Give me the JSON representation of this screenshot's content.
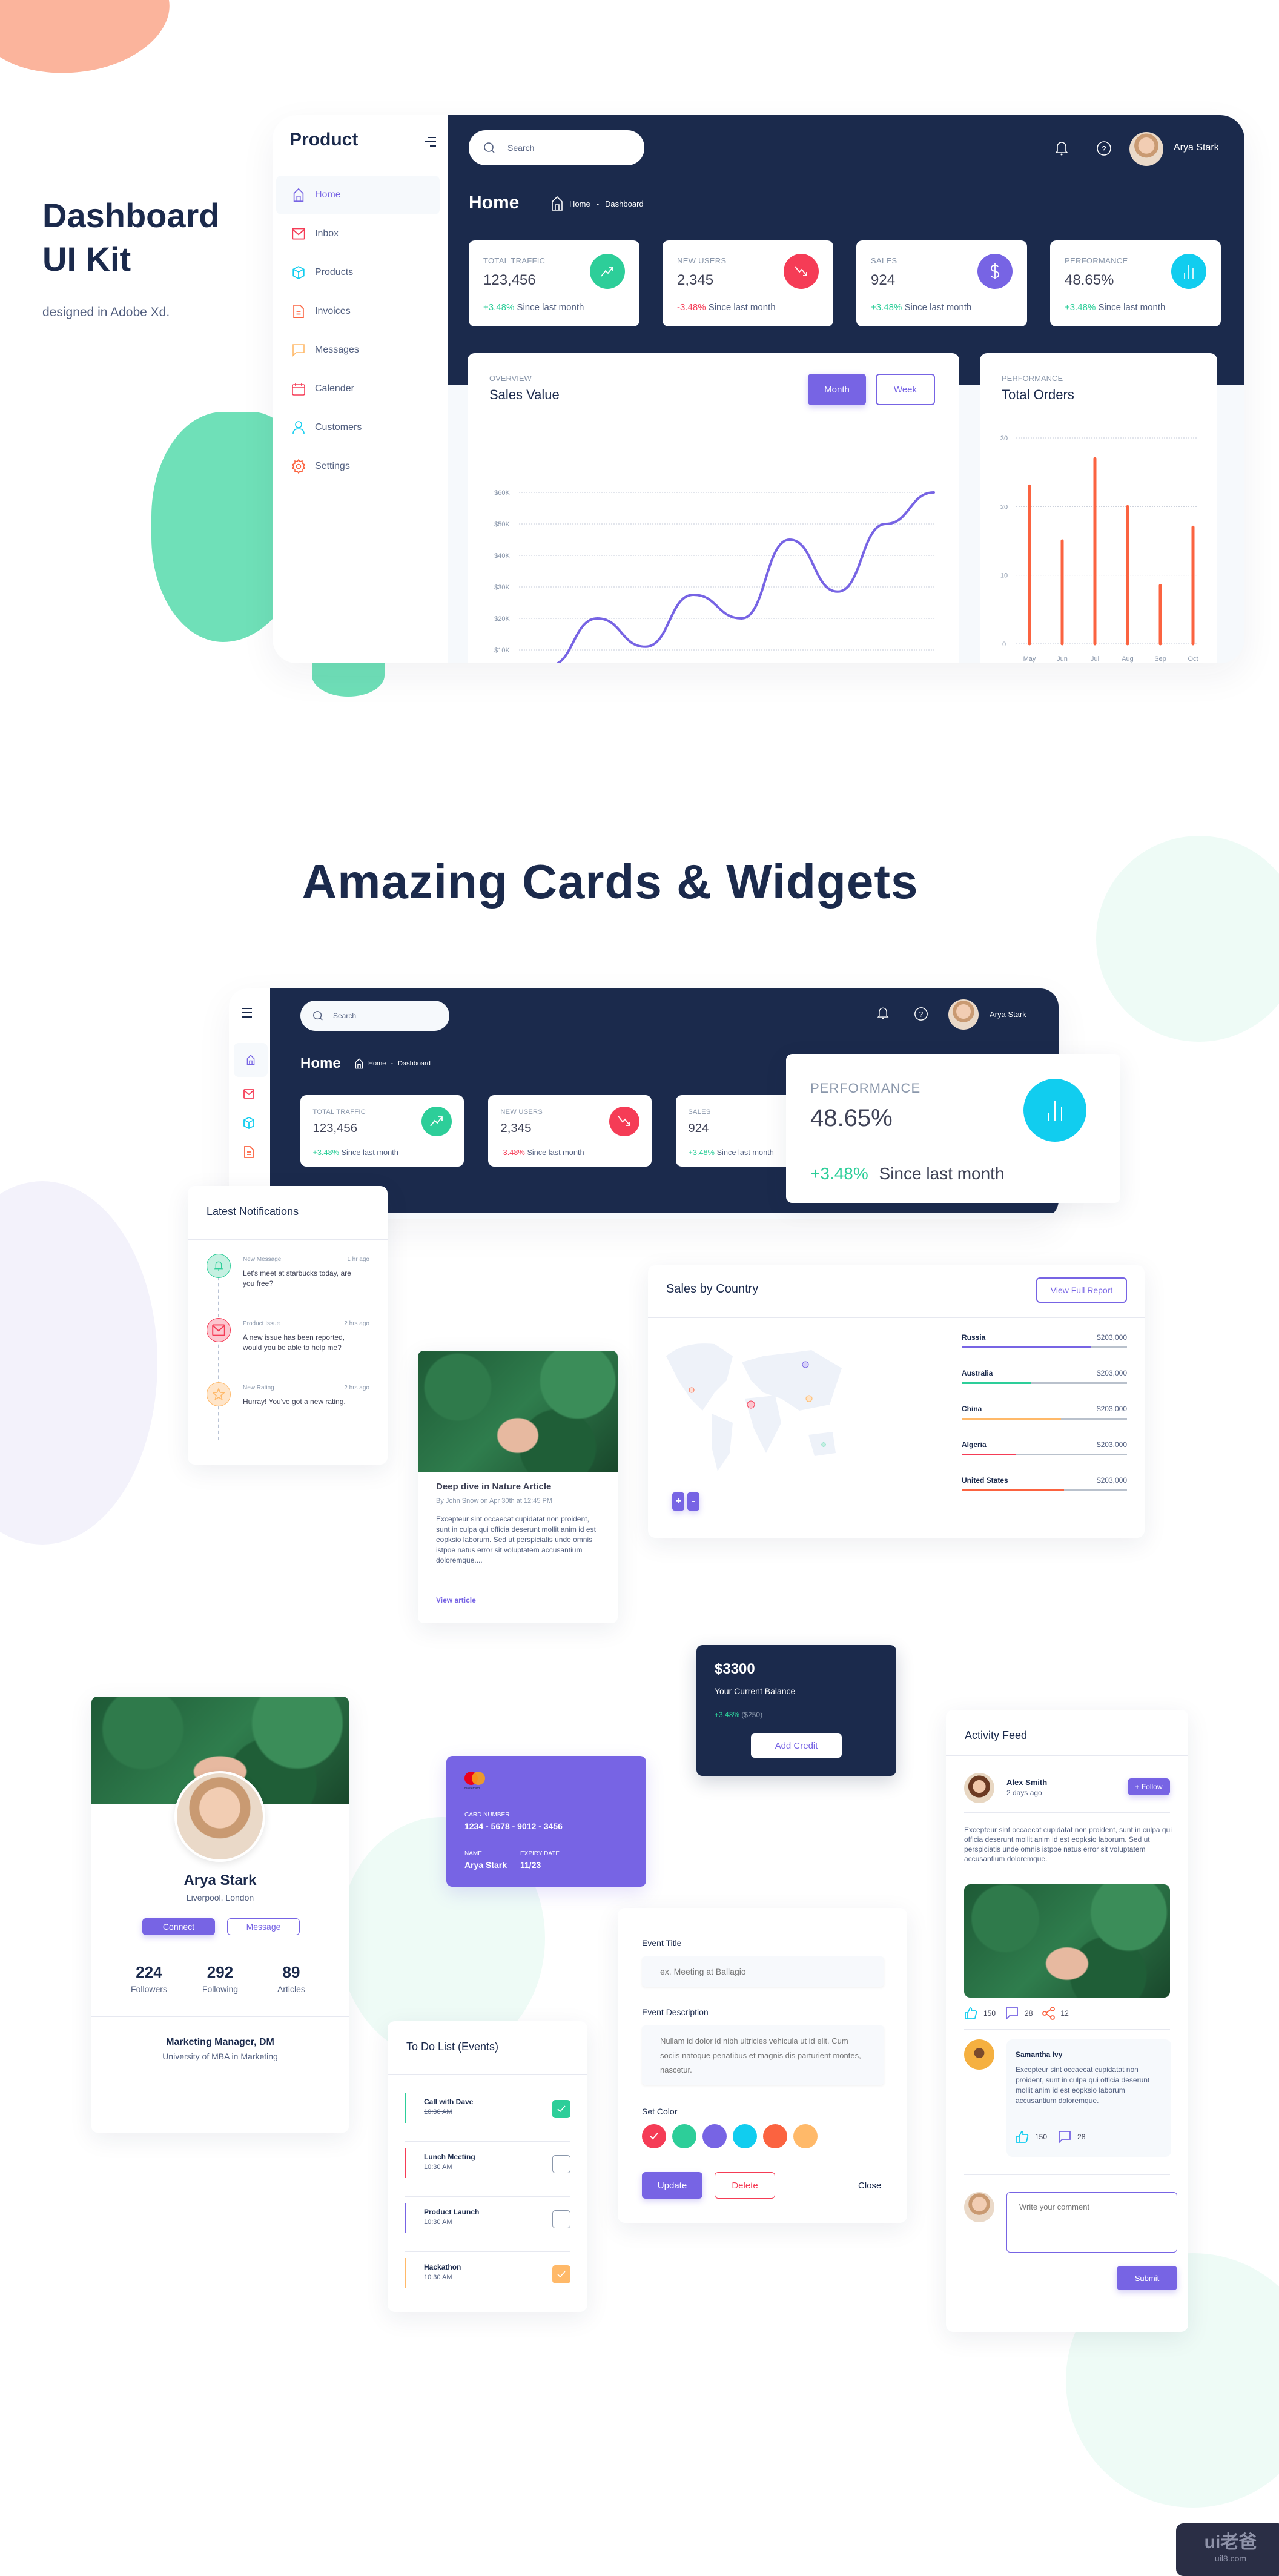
{
  "hero": {
    "title_line1": "Dashboard",
    "title_line2": "UI Kit",
    "subtitle": "designed in Adobe Xd."
  },
  "section_heading": "Amazing Cards & Widgets",
  "dashboard": {
    "brand": "Product",
    "sidebar": [
      {
        "label": "Home",
        "icon": "home-icon",
        "color": "#7764e4",
        "active": true
      },
      {
        "label": "Inbox",
        "icon": "mail-icon",
        "color": "#f53c56"
      },
      {
        "label": "Products",
        "icon": "box-icon",
        "color": "#11cdef"
      },
      {
        "label": "Invoices",
        "icon": "document-icon",
        "color": "#fb6340"
      },
      {
        "label": "Messages",
        "icon": "chat-icon",
        "color": "#ffb969"
      },
      {
        "label": "Calender",
        "icon": "calendar-icon",
        "color": "#f53c56"
      },
      {
        "label": "Customers",
        "icon": "user-icon",
        "color": "#11cdef"
      },
      {
        "label": "Settings",
        "icon": "gear-icon",
        "color": "#fb6340"
      }
    ],
    "search_placeholder": "Search",
    "user_name": "Arya Stark",
    "page_title": "Home",
    "breadcrumb": [
      "Home",
      "-",
      "Dashboard"
    ],
    "stats": [
      {
        "label": "TOTAL TRAFFIC",
        "value": "123,456",
        "change": "+3.48%",
        "since": "Since last month",
        "trend": "up",
        "icon": "trend-up-icon",
        "color": "#2dce99"
      },
      {
        "label": "NEW USERS",
        "value": "2,345",
        "change": "-3.48%",
        "since": "Since last month",
        "trend": "down",
        "icon": "trend-down-icon",
        "color": "#f53c56"
      },
      {
        "label": "SALES",
        "value": "924",
        "change": "+3.48%",
        "since": "Since last month",
        "trend": "up",
        "icon": "dollar-icon",
        "color": "#7764e4"
      },
      {
        "label": "PERFORMANCE",
        "value": "48.65%",
        "change": "+3.48%",
        "since": "Since last month",
        "trend": "up",
        "icon": "bar-chart-icon",
        "color": "#11cdef"
      }
    ],
    "sales_card": {
      "overline": "OVERVIEW",
      "title": "Sales Value",
      "btn_month": "Month",
      "btn_week": "Week"
    },
    "orders_card": {
      "overline": "PERFORMANCE",
      "title": "Total Orders"
    }
  },
  "chart_data": [
    {
      "type": "line",
      "title": "Sales Value",
      "ylabel": "",
      "xlabel": "",
      "yticks": [
        "$10K",
        "$20K",
        "$30K",
        "$40K",
        "$50K",
        "$60K"
      ],
      "ylim": [
        10,
        60
      ],
      "x": [
        0,
        1,
        2,
        3,
        4,
        5,
        6,
        7,
        8,
        9,
        10
      ],
      "values": [
        5,
        20,
        11,
        27.5,
        20,
        45,
        28.5,
        50,
        60
      ],
      "grid": true,
      "color": "#7764e4"
    },
    {
      "type": "bar",
      "title": "Total Orders",
      "categories": [
        "May",
        "Jun",
        "Jul",
        "Aug",
        "Sep",
        "Oct"
      ],
      "values": [
        23,
        15,
        27,
        20,
        8.5,
        17
      ],
      "yticks": [
        "0",
        "10",
        "20",
        "30"
      ],
      "ylim": [
        0,
        30
      ],
      "grid": true,
      "color": "#fb6340"
    }
  ],
  "widgets": {
    "mini_dash": {
      "search_placeholder": "Search",
      "user_name": "Arya Stark",
      "page_title": "Home",
      "breadcrumb": [
        "Home",
        "-",
        "Dashboard"
      ]
    },
    "performance_card": {
      "label": "PERFORMANCE",
      "value": "48.65%",
      "change": "+3.48%",
      "since": "Since last month"
    },
    "notifications": {
      "title": "Latest Notifications",
      "items": [
        {
          "type": "New Message",
          "time": "1 hr ago",
          "text": "Let's meet at starbucks today, are you free?",
          "icon": "bell-icon",
          "color": "#2dce99",
          "bg": "#c5f0e1"
        },
        {
          "type": "Product Issue",
          "time": "2 hrs ago",
          "text": "A new issue has been reported, would you be able to help me?",
          "icon": "mail-icon",
          "color": "#f53c56",
          "bg": "#fcc6cf"
        },
        {
          "type": "New Rating",
          "time": "2 hrs ago",
          "text": "Hurray! You've got a new rating.",
          "icon": "star-icon",
          "color": "#ffb969",
          "bg": "#ffe5c9"
        }
      ]
    },
    "sales_by_country": {
      "title": "Sales by Country",
      "button": "View Full Report",
      "zoom_in": "+",
      "zoom_out": "-",
      "countries": [
        {
          "name": "Russia",
          "amount": "$203,000",
          "progress": 0.78,
          "color": "#7764e4"
        },
        {
          "name": "Australia",
          "amount": "$203,000",
          "progress": 0.42,
          "color": "#2dce99"
        },
        {
          "name": "China",
          "amount": "$203,000",
          "progress": 0.6,
          "color": "#ffb969"
        },
        {
          "name": "Algeria",
          "amount": "$203,000",
          "progress": 0.33,
          "color": "#f53c56"
        },
        {
          "name": "United States",
          "amount": "$203,000",
          "progress": 0.62,
          "color": "#fb6340"
        }
      ]
    },
    "article": {
      "title": "Deep dive in Nature Article",
      "meta": "By John Snow on Apr 30th at 12:45 PM",
      "body": "Excepteur sint occaecat cupidatat non proident, sunt in culpa qui officia deserunt mollit anim id est eopksio laborum. Sed ut perspiciatis unde omnis istpoe natus error sit voluptatem accusantium doloremque....",
      "link": "View article"
    },
    "balance": {
      "amount": "$3300",
      "label": "Your Current Balance",
      "change": "+3.48%",
      "change_amount": "($250)",
      "button": "Add Credit"
    },
    "credit_card": {
      "brand": "mastercard",
      "number_label": "CARD NUMBER",
      "number": "1234 - 5678 - 9012 - 3456",
      "name_label": "NAME",
      "name": "Arya Stark",
      "expiry_label": "EXPIRY DATE",
      "expiry": "11/23"
    },
    "profile": {
      "name": "Arya Stark",
      "location": "Liverpool, London",
      "connect": "Connect",
      "message": "Message",
      "stats": [
        {
          "value": "224",
          "label": "Followers"
        },
        {
          "value": "292",
          "label": "Following"
        },
        {
          "value": "89",
          "label": "Articles"
        }
      ],
      "role": "Marketing Manager, DM",
      "education": "University of MBA in Marketing"
    },
    "event_form": {
      "title_label": "Event Title",
      "title_placeholder": "ex. Meeting at Ballagio",
      "desc_label": "Event Description",
      "desc_placeholder": "Nullam id dolor id nibh ultricies vehicula ut id elit. Cum sociis natoque penatibus et magnis dis parturient montes, nascetur.",
      "color_label": "Set Color",
      "colors": [
        "#f53c56",
        "#2dce99",
        "#7764e4",
        "#11cdef",
        "#fb6340",
        "#ffb969"
      ],
      "selected_color": 0,
      "update": "Update",
      "delete": "Delete",
      "close": "Close"
    },
    "todo": {
      "title": "To Do List (Events)",
      "items": [
        {
          "title": "Call with Dave",
          "time": "10:30 AM",
          "done": true,
          "color": "#2dce99"
        },
        {
          "title": "Lunch Meeting",
          "time": "10:30 AM",
          "done": false,
          "color": "#f53c56"
        },
        {
          "title": "Product Launch",
          "time": "10:30 AM",
          "done": false,
          "color": "#7764e4"
        },
        {
          "title": "Hackathon",
          "time": "10:30 AM",
          "done": true,
          "color": "#ffb969"
        }
      ]
    },
    "activity": {
      "title": "Activity Feed",
      "author": "Alex Smith",
      "time": "2 days ago",
      "follow": "+ Follow",
      "body": "Excepteur sint occaecat cupidatat non proident, sunt in culpa qui officia deserunt mollit anim id est eopksio laborum. Sed ut perspiciatis unde omnis istpoe natus error sit voluptatem accusantium doloremque.",
      "likes": "150",
      "comments": "28",
      "shares": "12",
      "comment": {
        "author": "Samantha Ivy",
        "text": "Excepteur sint occaecat cupidatat non proident, sunt in culpa qui officia deserunt mollit anim id est eopksio laborum accusantium doloremque.",
        "likes": "150",
        "comments": "28"
      },
      "input_placeholder": "Write your comment",
      "submit": "Submit"
    }
  },
  "watermark": {
    "logo": "ui老爸",
    "site": "uil8.com"
  }
}
